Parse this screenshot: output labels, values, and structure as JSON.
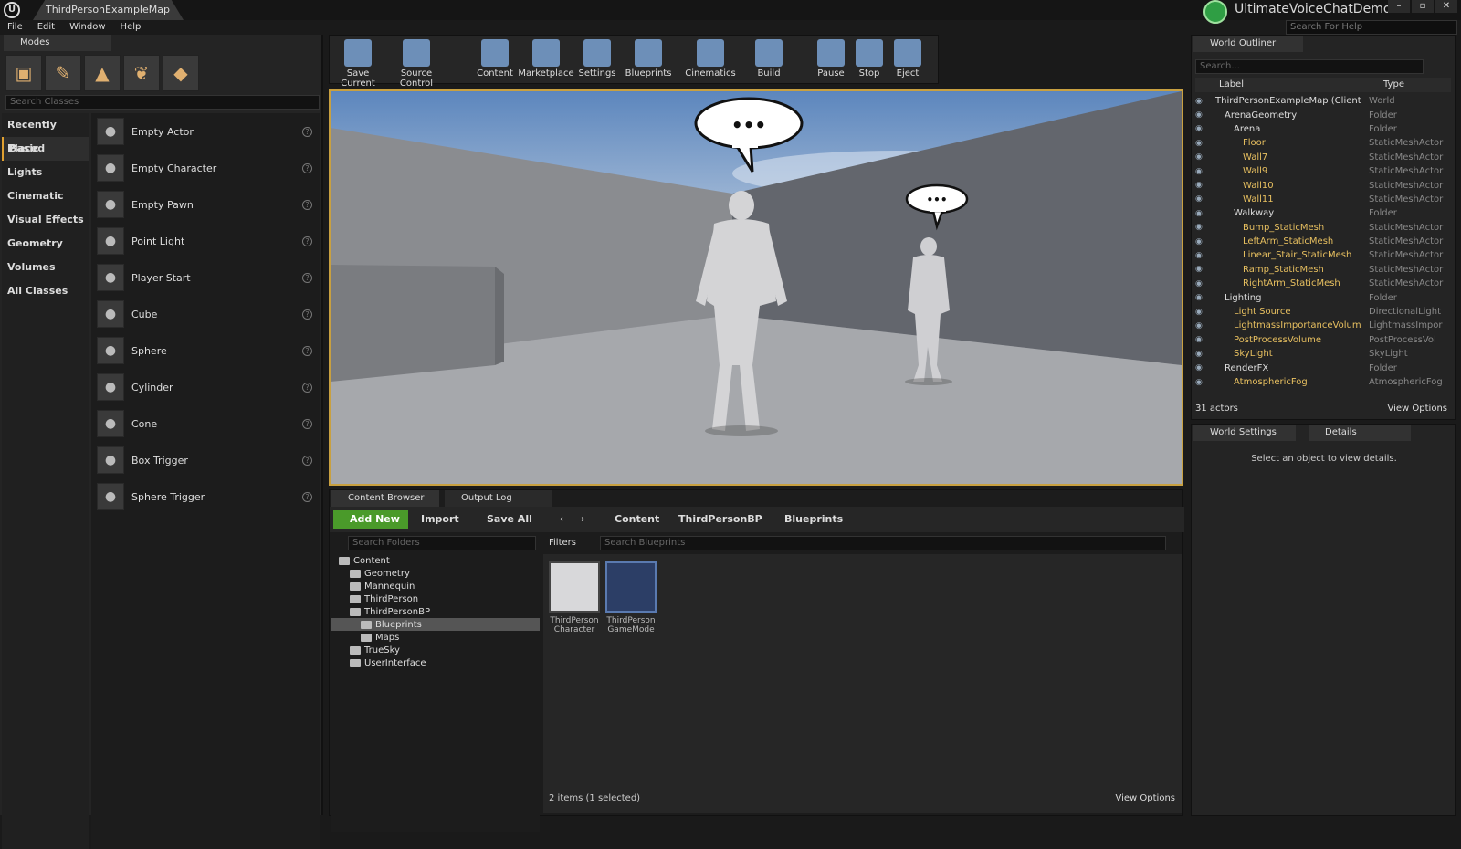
{
  "window": {
    "map_tab": "ThirdPersonExampleMap",
    "project_name": "UltimateVoiceChatDemo",
    "help_search_placeholder": "Search For Help",
    "controls": [
      "–",
      "▫",
      "✕"
    ]
  },
  "menu": [
    "File",
    "Edit",
    "Window",
    "Help"
  ],
  "modes": {
    "tab_label": "Modes",
    "search_placeholder": "Search Classes",
    "categories": [
      "Recently Placed",
      "Basic",
      "Lights",
      "Cinematic",
      "Visual Effects",
      "Geometry",
      "Volumes",
      "All Classes"
    ],
    "selected_category": "Basic",
    "classes": [
      {
        "label": "Empty Actor",
        "icon": "sphere-icon"
      },
      {
        "label": "Empty Character",
        "icon": "character-icon"
      },
      {
        "label": "Empty Pawn",
        "icon": "pawn-icon"
      },
      {
        "label": "Point Light",
        "icon": "light-bulb-icon"
      },
      {
        "label": "Player Start",
        "icon": "player-start-icon"
      },
      {
        "label": "Cube",
        "icon": "cube-icon"
      },
      {
        "label": "Sphere",
        "icon": "sphere-icon"
      },
      {
        "label": "Cylinder",
        "icon": "cylinder-icon"
      },
      {
        "label": "Cone",
        "icon": "cone-icon"
      },
      {
        "label": "Box Trigger",
        "icon": "box-trigger-icon"
      },
      {
        "label": "Sphere Trigger",
        "icon": "sphere-trigger-icon"
      }
    ]
  },
  "toolbar": {
    "buttons": [
      {
        "label": "Save Current",
        "icon": "save-icon"
      },
      {
        "label": "Source Control",
        "icon": "source-control-icon"
      },
      {
        "label": "Content",
        "icon": "content-icon"
      },
      {
        "label": "Marketplace",
        "icon": "marketplace-icon"
      },
      {
        "label": "Settings",
        "icon": "settings-icon"
      },
      {
        "label": "Blueprints",
        "icon": "blueprints-icon"
      },
      {
        "label": "Cinematics",
        "icon": "cinematics-icon"
      },
      {
        "label": "Build",
        "icon": "build-icon"
      },
      {
        "label": "Pause",
        "icon": "pause-icon"
      },
      {
        "label": "Stop",
        "icon": "stop-icon"
      },
      {
        "label": "Eject",
        "icon": "eject-icon"
      }
    ]
  },
  "viewport": {
    "bubble_text": "•••"
  },
  "outliner": {
    "tab_label": "World Outliner",
    "search_placeholder": "Search...",
    "col_label": "Label",
    "col_type": "Type",
    "rows": [
      {
        "name": "ThirdPersonExampleMap (Client",
        "type": "World",
        "depth": 0,
        "kind": "world"
      },
      {
        "name": "ArenaGeometry",
        "type": "Folder",
        "depth": 1,
        "kind": "folder"
      },
      {
        "name": "Arena",
        "type": "Folder",
        "depth": 2,
        "kind": "folder"
      },
      {
        "name": "Floor",
        "type": "StaticMeshActor",
        "depth": 3,
        "kind": "actor"
      },
      {
        "name": "Wall7",
        "type": "StaticMeshActor",
        "depth": 3,
        "kind": "actor"
      },
      {
        "name": "Wall9",
        "type": "StaticMeshActor",
        "depth": 3,
        "kind": "actor"
      },
      {
        "name": "Wall10",
        "type": "StaticMeshActor",
        "depth": 3,
        "kind": "actor"
      },
      {
        "name": "Wall11",
        "type": "StaticMeshActor",
        "depth": 3,
        "kind": "actor"
      },
      {
        "name": "Walkway",
        "type": "Folder",
        "depth": 2,
        "kind": "folder"
      },
      {
        "name": "Bump_StaticMesh",
        "type": "StaticMeshActor",
        "depth": 3,
        "kind": "actor"
      },
      {
        "name": "LeftArm_StaticMesh",
        "type": "StaticMeshActor",
        "depth": 3,
        "kind": "actor"
      },
      {
        "name": "Linear_Stair_StaticMesh",
        "type": "StaticMeshActor",
        "depth": 3,
        "kind": "actor"
      },
      {
        "name": "Ramp_StaticMesh",
        "type": "StaticMeshActor",
        "depth": 3,
        "kind": "actor"
      },
      {
        "name": "RightArm_StaticMesh",
        "type": "StaticMeshActor",
        "depth": 3,
        "kind": "actor"
      },
      {
        "name": "Lighting",
        "type": "Folder",
        "depth": 1,
        "kind": "folder"
      },
      {
        "name": "Light Source",
        "type": "DirectionalLight",
        "depth": 2,
        "kind": "actor"
      },
      {
        "name": "LightmassImportanceVolum",
        "type": "LightmassImpor",
        "depth": 2,
        "kind": "actor"
      },
      {
        "name": "PostProcessVolume",
        "type": "PostProcessVol",
        "depth": 2,
        "kind": "actor"
      },
      {
        "name": "SkyLight",
        "type": "SkyLight",
        "depth": 2,
        "kind": "actor"
      },
      {
        "name": "RenderFX",
        "type": "Folder",
        "depth": 1,
        "kind": "folder"
      },
      {
        "name": "AtmosphericFog",
        "type": "AtmosphericFog",
        "depth": 2,
        "kind": "actor"
      }
    ],
    "actor_count": "31 actors",
    "view_options": "View Options"
  },
  "details": {
    "tab_world_settings": "World Settings",
    "tab_details": "Details",
    "empty_text": "Select an object to view details."
  },
  "content_browser": {
    "tab_label": "Content Browser",
    "output_log_tab": "Output Log",
    "add_new": "Add New",
    "import": "Import",
    "save_all": "Save All",
    "path": [
      "Content",
      "ThirdPersonBP",
      "Blueprints"
    ],
    "folder_search_placeholder": "Search Folders",
    "filters": "Filters",
    "asset_search_placeholder": "Search Blueprints",
    "folders": [
      {
        "name": "Content",
        "depth": 0
      },
      {
        "name": "Geometry",
        "depth": 1
      },
      {
        "name": "Mannequin",
        "depth": 1
      },
      {
        "name": "ThirdPerson",
        "depth": 1
      },
      {
        "name": "ThirdPersonBP",
        "depth": 1
      },
      {
        "name": "Blueprints",
        "depth": 2,
        "selected": true
      },
      {
        "name": "Maps",
        "depth": 2
      },
      {
        "name": "TrueSky",
        "depth": 1
      },
      {
        "name": "UserInterface",
        "depth": 1
      }
    ],
    "assets": [
      {
        "name": "ThirdPerson Character",
        "selected": true
      },
      {
        "name": "ThirdPerson GameMode",
        "selected": false
      }
    ],
    "status": "2 items (1 selected)",
    "view_options": "View Options"
  },
  "colors": {
    "accent": "#c8a040",
    "add_new_green": "#4a9a2a",
    "actor_name": "#e8c060"
  }
}
